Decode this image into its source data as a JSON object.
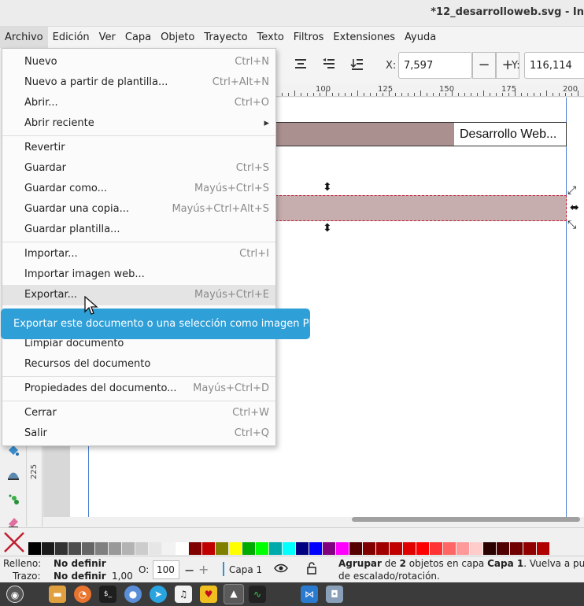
{
  "window": {
    "title": "*12_desarrolloweb.svg - In"
  },
  "menubar": {
    "items": [
      "Archivo",
      "Edición",
      "Ver",
      "Capa",
      "Objeto",
      "Trayecto",
      "Texto",
      "Filtros",
      "Extensiones",
      "Ayuda"
    ],
    "active": "Archivo"
  },
  "toolbar": {
    "x_label": "X:",
    "x_value": "7,597",
    "y_label": "Y:",
    "y_value": "116,114",
    "minus": "−",
    "plus": "+"
  },
  "ruler": {
    "h_labels": [
      "100",
      "125",
      "150",
      "175",
      "200"
    ],
    "v_labels": [
      "225"
    ]
  },
  "canvas": {
    "text_object": "Desarrollo Web..."
  },
  "file_menu": {
    "items": [
      {
        "label": "Nuevo",
        "shortcut": "Ctrl+N"
      },
      {
        "label": "Nuevo a partir de plantilla...",
        "shortcut": "Ctrl+Alt+N"
      },
      {
        "label": "Abrir...",
        "shortcut": "Ctrl+O"
      },
      {
        "label": "Abrir reciente",
        "shortcut": "▸"
      },
      {
        "label": "Revertir",
        "shortcut": ""
      },
      {
        "label": "Guardar",
        "shortcut": "Ctrl+S"
      },
      {
        "label": "Guardar como...",
        "shortcut": "Mayús+Ctrl+S"
      },
      {
        "label": "Guardar una copia...",
        "shortcut": "Mayús+Ctrl+Alt+S"
      },
      {
        "label": "Guardar plantilla...",
        "shortcut": ""
      },
      {
        "label": "Importar...",
        "shortcut": "Ctrl+I"
      },
      {
        "label": "Importar imagen web...",
        "shortcut": ""
      },
      {
        "label": "Exportar...",
        "shortcut": "Mayús+Ctrl+E"
      },
      {
        "label": "Limpiar documento",
        "shortcut": ""
      },
      {
        "label": "Recursos del documento",
        "shortcut": ""
      },
      {
        "label": "Propiedades del documento...",
        "shortcut": "Mayús+Ctrl+D"
      },
      {
        "label": "Cerrar",
        "shortcut": "Ctrl+W"
      },
      {
        "label": "Salir",
        "shortcut": "Ctrl+Q"
      }
    ],
    "highlighted": "Exportar..."
  },
  "tooltip": {
    "text": "Exportar este documento o una selección como imagen PNG"
  },
  "status": {
    "fill_label": "Relleno:",
    "fill_value": "No definir",
    "stroke_label": "Trazo:",
    "stroke_value": "No definir",
    "stroke_width": "1,00",
    "opacity_label": "O:",
    "opacity_value": "100",
    "layer": "Capa 1",
    "message_bold1": "Agrupar",
    "message_part1": " de ",
    "message_bold2": "2",
    "message_part2": " objetos en capa ",
    "message_bold3": "Capa 1",
    "message_part3": ". Vuelva a puls",
    "message_line2": "de escalado/rotación."
  },
  "palette": {
    "colors": [
      "#000000",
      "#1a1a1a",
      "#333333",
      "#4d4d4d",
      "#666666",
      "#808080",
      "#999999",
      "#b3b3b3",
      "#cccccc",
      "#e6e6e6",
      "#f2f2f2",
      "#ffffff",
      "#800000",
      "#c00000",
      "#808000",
      "#ffff00",
      "#00aa00",
      "#00ff00",
      "#00aaaa",
      "#00ffff",
      "#000080",
      "#0000ff",
      "#800080",
      "#ff00ff",
      "#550000",
      "#800000",
      "#a00000",
      "#c00000",
      "#e00000",
      "#ff0000",
      "#ff3333",
      "#ff6666",
      "#ff9999",
      "#ffcccc",
      "#2a0000",
      "#500000",
      "#700000",
      "#900000",
      "#b00000"
    ]
  },
  "taskbar": {
    "icons": [
      "mint-menu-icon",
      "folder-icon",
      "firefox-icon",
      "terminal-icon",
      "chromium-icon",
      "telegram-icon",
      "music-icon",
      "app-yellow-icon",
      "inkscape-icon",
      "system-monitor-icon",
      "vscode-icon",
      "camera-icon"
    ]
  }
}
